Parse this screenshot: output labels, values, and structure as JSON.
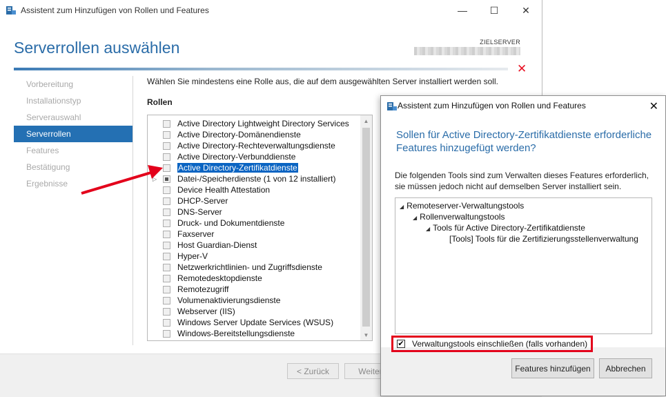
{
  "main_window": {
    "title": "Assistent zum Hinzufügen von Rollen und Features",
    "page_title": "Serverrollen auswählen",
    "target_server_label": "ZIELSERVER",
    "window_controls": {
      "minimize": "—",
      "maximize": "☐",
      "close": "✕"
    },
    "close_error_icon": "✕",
    "instruction": "Wählen Sie mindestens eine Rolle aus, die auf dem ausgewählten Server installiert werden soll.",
    "roles_label": "Rollen",
    "nav": [
      {
        "label": "Vorbereitung"
      },
      {
        "label": "Installationstyp"
      },
      {
        "label": "Serverauswahl"
      },
      {
        "label": "Serverrollen",
        "active": true
      },
      {
        "label": "Features"
      },
      {
        "label": "Bestätigung"
      },
      {
        "label": "Ergebnisse"
      }
    ],
    "roles": [
      {
        "label": "Active Directory Lightweight Directory Services"
      },
      {
        "label": "Active Directory-Domänendienste"
      },
      {
        "label": "Active Directory-Rechteverwaltungsdienste"
      },
      {
        "label": "Active Directory-Verbunddienste"
      },
      {
        "label": "Active Directory-Zertifikatdienste",
        "selected": true
      },
      {
        "label": "Datei-/Speicherdienste (1 von 12 installiert)",
        "partial": true,
        "expandable": true
      },
      {
        "label": "Device Health Attestation"
      },
      {
        "label": "DHCP-Server"
      },
      {
        "label": "DNS-Server"
      },
      {
        "label": "Druck- und Dokumentdienste"
      },
      {
        "label": "Faxserver"
      },
      {
        "label": "Host Guardian-Dienst"
      },
      {
        "label": "Hyper-V"
      },
      {
        "label": "Netzwerkrichtlinien- und Zugriffsdienste"
      },
      {
        "label": "Remotedesktopdienste"
      },
      {
        "label": "Remotezugriff"
      },
      {
        "label": "Volumenaktivierungsdienste"
      },
      {
        "label": "Webserver (IIS)"
      },
      {
        "label": "Windows Server Update Services (WSUS)"
      },
      {
        "label": "Windows-Bereitstellungsdienste"
      }
    ],
    "buttons": {
      "back": "< Zurück",
      "next": "Weiter"
    }
  },
  "dialog": {
    "title": "Assistent zum Hinzufügen von Rollen und Features",
    "close": "✕",
    "heading": "Sollen für Active Directory-Zertifikatdienste erforderliche Features hinzugefügt werden?",
    "description": "Die folgenden Tools sind zum Verwalten dieses Features erforderlich, sie müssen jedoch nicht auf demselben Server installiert sein.",
    "tree": [
      {
        "label": "Remoteserver-Verwaltungstools",
        "level": 0,
        "expanded": true
      },
      {
        "label": "Rollenverwaltungstools",
        "level": 1,
        "expanded": true
      },
      {
        "label": "Tools für Active Directory-Zertifikatdienste",
        "level": 2,
        "expanded": true
      },
      {
        "label": "[Tools] Tools für die Zertifizierungsstellenverwaltung",
        "level": 3,
        "expanded": false
      }
    ],
    "include_tools_label": "Verwaltungstools einschließen (falls vorhanden)",
    "include_tools_checked": true,
    "buttons": {
      "add": "Features hinzufügen",
      "cancel": "Abbrechen"
    }
  },
  "colors": {
    "accent": "#2a6ca8",
    "selection": "#0a64c2",
    "highlight_red": "#e3001b"
  }
}
